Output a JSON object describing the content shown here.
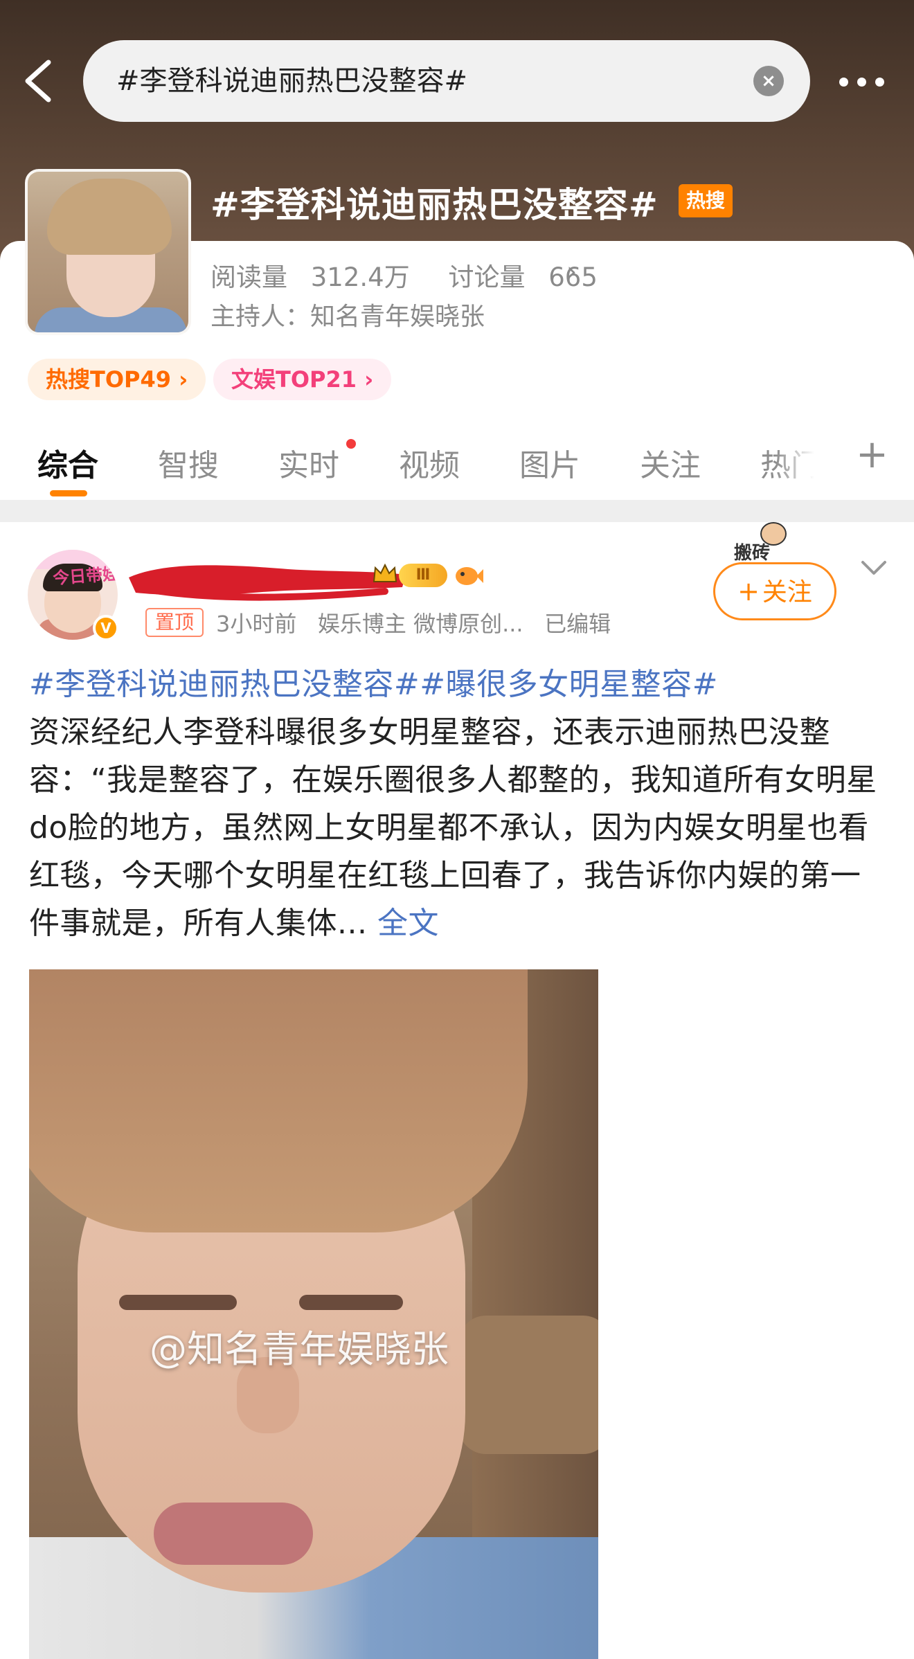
{
  "header": {
    "search_query": "#李登科说迪丽热巴没整容#",
    "topic_title": "#李登科说迪丽热巴没整容#",
    "hot_badge": "热搜"
  },
  "topic": {
    "reads_label": "阅读量",
    "reads_value": "312.4万",
    "discussion_label": "讨论量",
    "discussion_value": "665",
    "host_label": "主持人：",
    "host_name": "知名青年娱晓张",
    "rank_hot": "热搜TOP49",
    "rank_ent": "文娱TOP21"
  },
  "tabs": [
    {
      "label": "综合",
      "active": true
    },
    {
      "label": "智搜"
    },
    {
      "label": "实时",
      "has_dot": true
    },
    {
      "label": "视频"
    },
    {
      "label": "图片"
    },
    {
      "label": "关注"
    },
    {
      "label": "热门"
    }
  ],
  "post": {
    "avatar_text": "今日带娃",
    "level": "Ⅲ",
    "pin_label": "置顶",
    "time": "3小时前",
    "role": "娱乐博主",
    "source": "微博原创...",
    "edited": "已编辑",
    "sticker_text": "搬砖",
    "follow_label": "关注",
    "hashtag1": "#李登科说迪丽热巴没整容#",
    "hashtag2": "#曝很多女明星整容#",
    "body": "资深经纪人李登科曝很多女明星整容，还表示迪丽热巴没整容：“我是整容了，在娱乐圈很多人都整的，我知道所有女明星do脸的地方，虽然网上女明星都不承认，因为内娱女明星也看红毯，今天哪个女明星在红毯上回春了，我告诉你内娱的第一件事就是，所有人集体...",
    "full_text_link": "全文",
    "watermark": "@知名青年娱晓张"
  },
  "colors": {
    "accent": "#ff8200",
    "link": "#4b74c2",
    "header_bg": "#4e3a2e"
  }
}
